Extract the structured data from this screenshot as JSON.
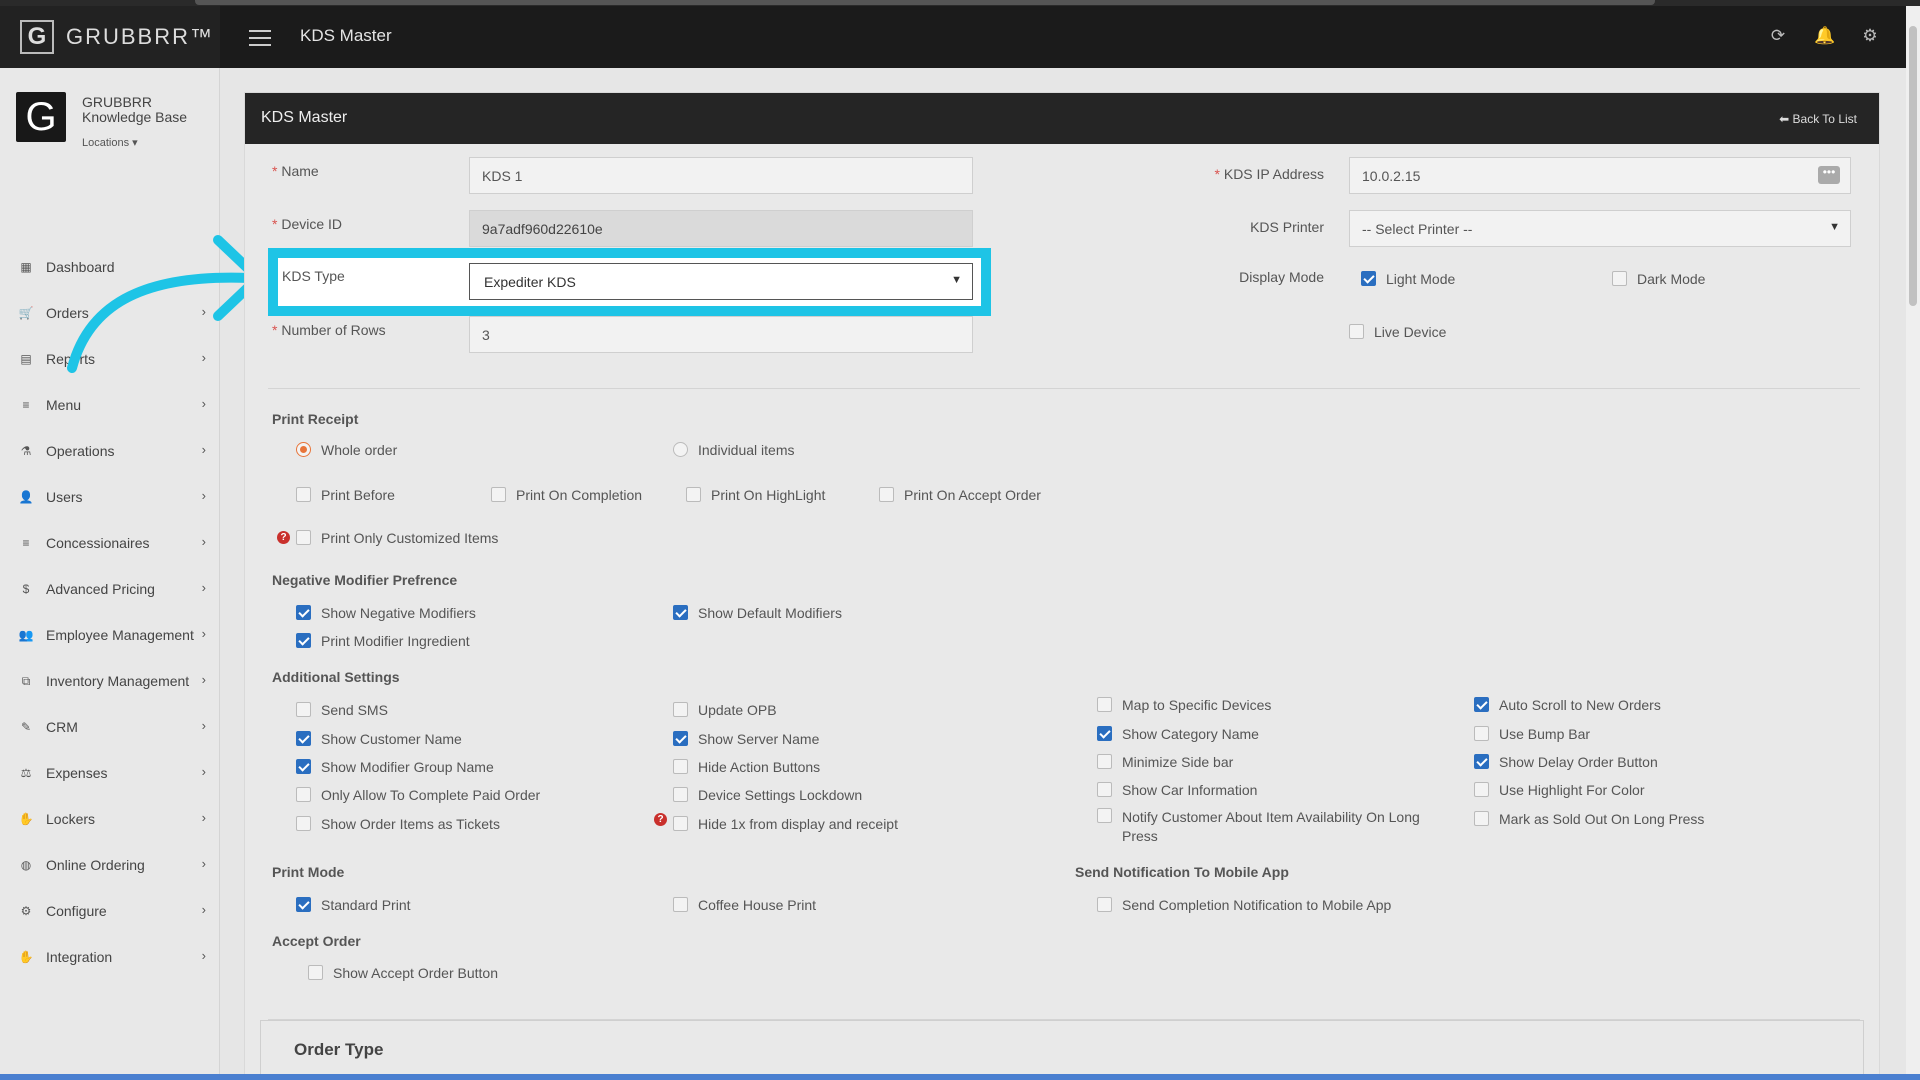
{
  "app": {
    "brand": "GRUBBRR™",
    "brand_mark": "G",
    "page_title": "KDS Master"
  },
  "topbar": {
    "icons": [
      "refresh-icon",
      "bell-icon",
      "gear-icon"
    ]
  },
  "profile": {
    "name": "GRUBBRR Knowledge Base",
    "locations_label": "Locations ▾",
    "avatar_letter": "G"
  },
  "sidebar": {
    "items": [
      {
        "label": "Dashboard",
        "icon": "▦",
        "has_children": false
      },
      {
        "label": "Orders",
        "icon": "🛒",
        "has_children": true
      },
      {
        "label": "Reports",
        "icon": "▤",
        "has_children": true
      },
      {
        "label": "Menu",
        "icon": "≡",
        "has_children": true
      },
      {
        "label": "Operations",
        "icon": "⚗",
        "has_children": true
      },
      {
        "label": "Users",
        "icon": "👤",
        "has_children": true
      },
      {
        "label": "Concessionaires",
        "icon": "≡",
        "has_children": true
      },
      {
        "label": "Advanced Pricing",
        "icon": "$",
        "has_children": true
      },
      {
        "label": "Employee Management",
        "icon": "👥",
        "has_children": true
      },
      {
        "label": "Inventory Management",
        "icon": "⧉",
        "has_children": true
      },
      {
        "label": "CRM",
        "icon": "✎",
        "has_children": true
      },
      {
        "label": "Expenses",
        "icon": "⚖",
        "has_children": true
      },
      {
        "label": "Lockers",
        "icon": "✋",
        "has_children": true
      },
      {
        "label": "Online Ordering",
        "icon": "◍",
        "has_children": true
      },
      {
        "label": "Configure",
        "icon": "⚙",
        "has_children": true
      },
      {
        "label": "Integration",
        "icon": "✋",
        "has_children": true
      }
    ]
  },
  "card": {
    "title": "KDS Master",
    "back_label": "⬅ Back To List"
  },
  "form": {
    "name_label": "Name",
    "name_value": "KDS 1",
    "device_id_label": "Device ID",
    "device_id_value": "9a7adf960d22610e",
    "kds_type_label": "KDS Type",
    "kds_type_value": "Expediter KDS",
    "rows_label": "Number of Rows",
    "rows_value": "3",
    "ip_label": "KDS IP Address",
    "ip_value": "10.0.2.15",
    "printer_label": "KDS Printer",
    "printer_value": "-- Select Printer --",
    "display_mode_label": "Display Mode",
    "light_mode": "Light Mode",
    "dark_mode": "Dark Mode",
    "live_device": "Live Device",
    "required_mark": "*"
  },
  "print_receipt": {
    "title": "Print Receipt",
    "whole_order": "Whole order",
    "individual_items": "Individual items",
    "print_before": "Print Before",
    "print_on_completion": "Print On Completion",
    "print_on_highlight": "Print On HighLight",
    "print_on_accept": "Print On Accept Order",
    "print_only_customized": "Print Only Customized Items"
  },
  "negative_modifier": {
    "title": "Negative Modifier Prefrence",
    "show_negative": "Show Negative Modifiers",
    "show_default": "Show Default Modifiers",
    "print_ingredient": "Print Modifier Ingredient"
  },
  "additional": {
    "title": "Additional Settings",
    "send_sms": "Send SMS",
    "update_opb": "Update OPB",
    "map_devices": "Map to Specific Devices",
    "auto_scroll": "Auto Scroll to New Orders",
    "show_customer": "Show Customer Name",
    "show_server": "Show Server Name",
    "show_category": "Show Category Name",
    "use_bump": "Use Bump Bar",
    "show_modifier_group": "Show Modifier Group Name",
    "hide_action": "Hide Action Buttons",
    "minimize_side": "Minimize Side bar",
    "show_delay": "Show Delay Order Button",
    "only_allow": "Only Allow To Complete Paid Order",
    "device_lockdown": "Device Settings Lockdown",
    "show_car": "Show Car Information",
    "use_highlight": "Use Highlight For Color",
    "show_tickets": "Show Order Items as Tickets",
    "hide_1x": "Hide 1x from display and receipt",
    "notify_customer": "Notify Customer About Item Availability On Long Press",
    "mark_sold_out": "Mark as Sold Out On Long Press"
  },
  "print_mode": {
    "title": "Print Mode",
    "standard": "Standard Print",
    "coffee": "Coffee House Print"
  },
  "send_notification": {
    "title": "Send Notification To Mobile App",
    "completion": "Send Completion Notification to Mobile App"
  },
  "accept_order": {
    "title": "Accept Order",
    "show_button": "Show Accept Order Button"
  },
  "order_type": {
    "title": "Order Type"
  },
  "colors": {
    "highlight": "#1ec4e6",
    "checkbox_on": "#2a6ec0",
    "radio_on": "#e8753a",
    "required": "#d9534f"
  }
}
